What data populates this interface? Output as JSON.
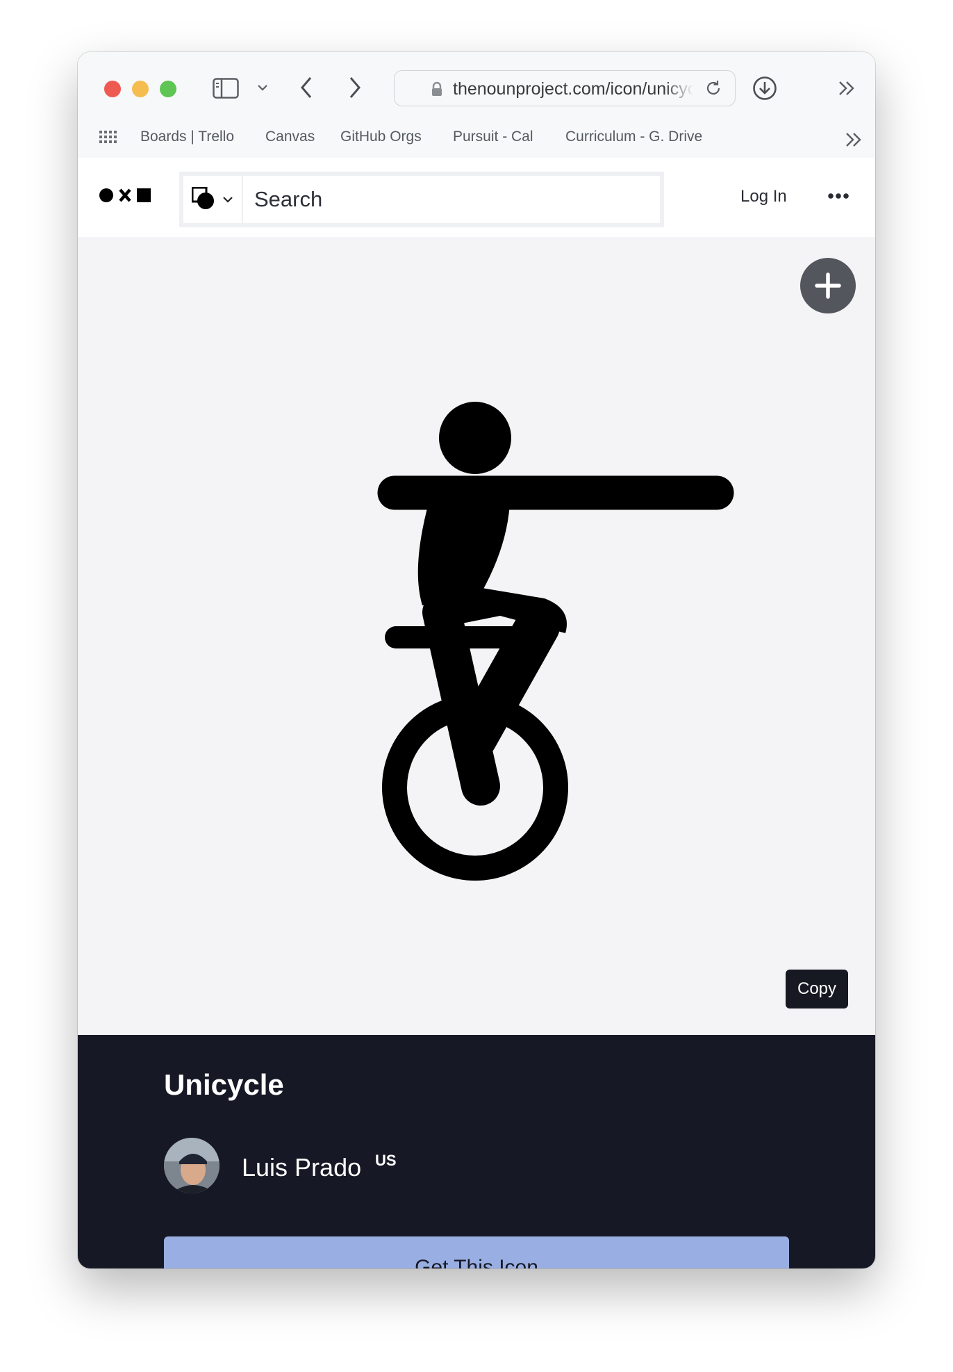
{
  "browser": {
    "url": "thenounproject.com/icon/unicycle",
    "bookmarks": [
      "Boards | Trello",
      "Canvas",
      "GitHub Orgs",
      "Pursuit - Cal",
      "Curriculum - G. Drive"
    ]
  },
  "header": {
    "search_placeholder": "Search",
    "login_label": "Log In"
  },
  "icon_view": {
    "icon_name": "unicycle-icon",
    "copy_label": "Copy"
  },
  "details": {
    "title": "Unicycle",
    "author": "Luis Prado",
    "country": "US",
    "cta_label": "Get This Icon"
  },
  "colors": {
    "panel_bg": "#161925",
    "cta_bg": "#99afe3",
    "stage_bg": "#f4f4f6",
    "fab_bg": "#54565e"
  }
}
